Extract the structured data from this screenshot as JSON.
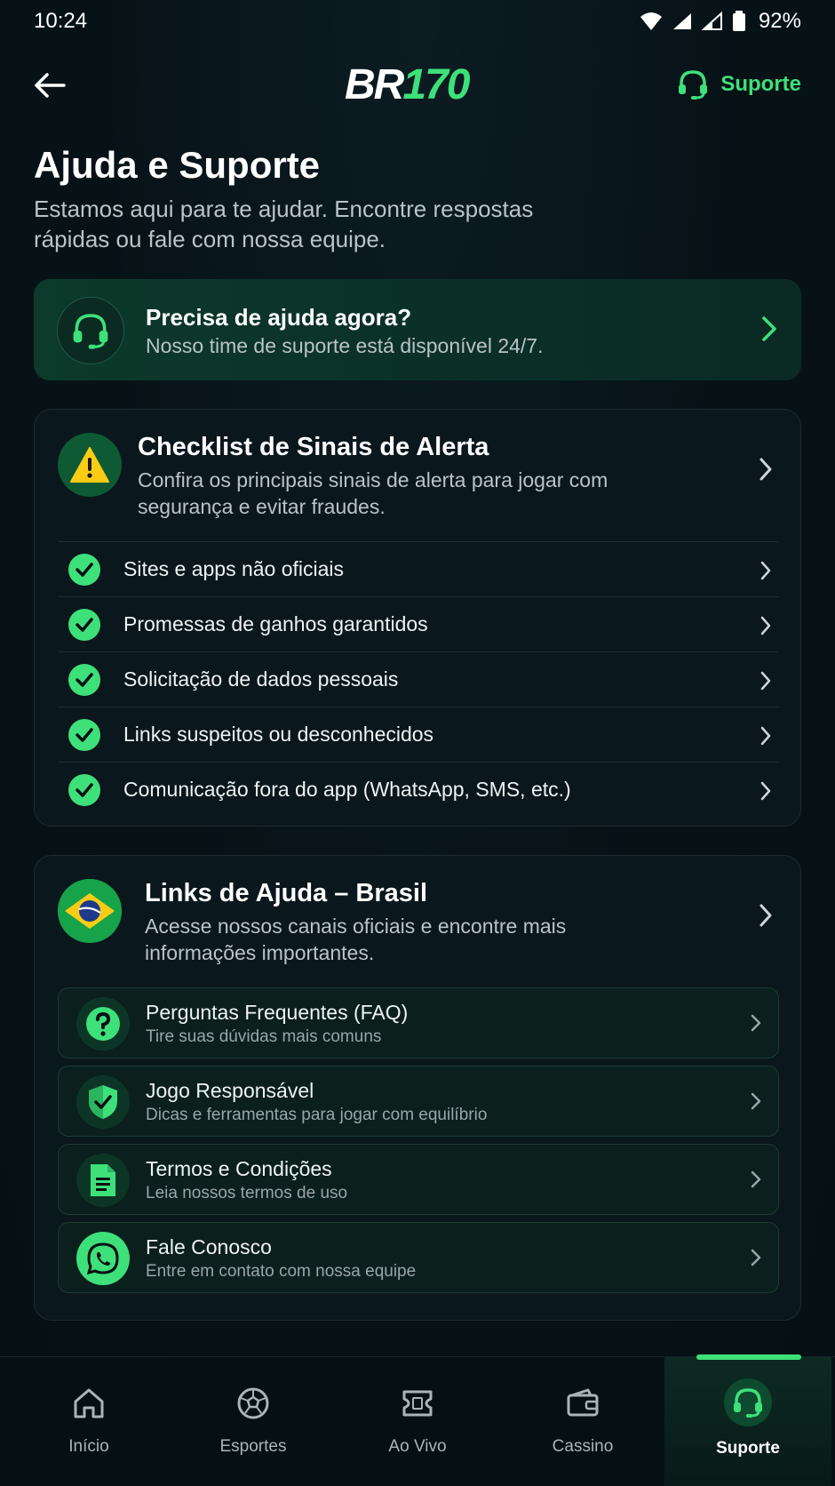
{
  "status_bar": {
    "time": "10:24",
    "battery": "92%"
  },
  "header": {
    "logo_a": "BR",
    "logo_b": "170",
    "support_label": "Suporte"
  },
  "page": {
    "title": "Ajuda e Suporte",
    "subtitle": "Estamos aqui para te ajudar. Encontre respostas rápidas ou fale com nossa equipe."
  },
  "help_banner": {
    "title": "Precisa de ajuda agora?",
    "text": "Nosso time de suporte está disponível 24/7."
  },
  "checklist": {
    "title": "Checklist de Sinais de Alerta",
    "description": "Confira os principais sinais de alerta para jogar com segurança e evitar fraudes.",
    "items": [
      {
        "label": "Sites e apps não oficiais"
      },
      {
        "label": "Promessas de ganhos garantidos"
      },
      {
        "label": "Solicitação de dados pessoais"
      },
      {
        "label": "Links suspeitos ou desconhecidos"
      },
      {
        "label": "Comunicação fora do app (WhatsApp, SMS, etc.)"
      }
    ]
  },
  "help_links": {
    "title": "Links de Ajuda – Brasil",
    "description": "Acesse nossos canais oficiais e encontre mais informações importantes.",
    "items": [
      {
        "icon": "question-icon",
        "title": "Perguntas Frequentes (FAQ)",
        "subtitle": "Tire suas dúvidas mais comuns"
      },
      {
        "icon": "shield-icon",
        "title": "Jogo Responsável",
        "subtitle": "Dicas e ferramentas para jogar com equilíbrio"
      },
      {
        "icon": "document-icon",
        "title": "Termos e Condições",
        "subtitle": "Leia nossos termos de uso"
      },
      {
        "icon": "whatsapp-icon",
        "title": "Fale Conosco",
        "subtitle": "Entre em contato com nossa equipe"
      }
    ]
  },
  "bottom_nav": {
    "items": [
      {
        "icon": "home-icon",
        "label": "Início"
      },
      {
        "icon": "soccer-ball-icon",
        "label": "Esportes"
      },
      {
        "icon": "ticket-icon",
        "label": "Ao Vivo"
      },
      {
        "icon": "wallet-icon",
        "label": "Cassino"
      },
      {
        "icon": "headset-icon",
        "label": "Suporte",
        "active": true
      }
    ]
  },
  "colors": {
    "background": "#071217",
    "accent": "#3ee07a",
    "warning": "#facc15",
    "muted_text": "#b9c3c8"
  }
}
